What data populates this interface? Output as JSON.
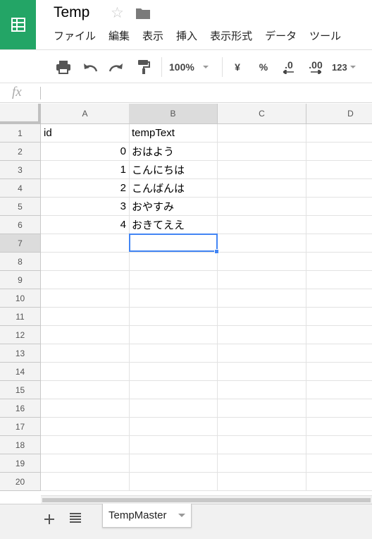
{
  "header": {
    "title": "Temp",
    "menu": [
      "ファイル",
      "編集",
      "表示",
      "挿入",
      "表示形式",
      "データ",
      "ツール"
    ]
  },
  "toolbar": {
    "zoom": "100%",
    "currency": "¥",
    "percent": "%",
    "decrease_decimals": ".0",
    "increase_decimals": ".00",
    "more_formats": "123"
  },
  "formula_bar": {
    "fx": "fx",
    "value": ""
  },
  "grid": {
    "columns": [
      "A",
      "B",
      "C",
      "D"
    ],
    "rows": [
      "1",
      "2",
      "3",
      "4",
      "5",
      "6",
      "7",
      "8",
      "9",
      "10",
      "11",
      "12",
      "13",
      "14",
      "15",
      "16",
      "17",
      "18",
      "19",
      "20"
    ],
    "selected_row": "7",
    "selected_column": "B",
    "cells": [
      [
        "id",
        "tempText"
      ],
      [
        "0",
        "おはよう"
      ],
      [
        "1",
        "こんにちは"
      ],
      [
        "2",
        "こんばんは"
      ],
      [
        "3",
        "おやすみ"
      ],
      [
        "4",
        "おきてええ"
      ]
    ]
  },
  "sheets": {
    "active": "TempMaster"
  },
  "colors": {
    "brand": "#23a566",
    "selection": "#4285f4"
  }
}
